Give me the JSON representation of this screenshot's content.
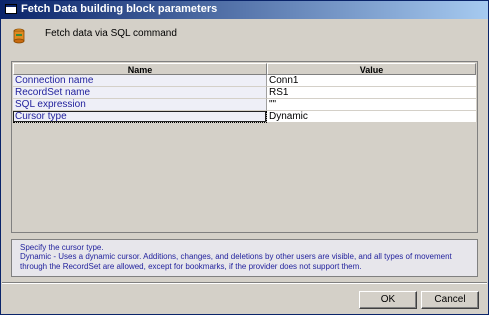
{
  "window": {
    "title": "Fetch Data building block parameters"
  },
  "header": {
    "text": "Fetch data via SQL command"
  },
  "grid": {
    "columns": {
      "name": "Name",
      "value": "Value"
    },
    "rows": [
      {
        "name": "Connection name",
        "value": "Conn1"
      },
      {
        "name": "RecordSet name",
        "value": "RS1"
      },
      {
        "name": "SQL expression",
        "value": "\"\""
      },
      {
        "name": "Cursor type",
        "value": "Dynamic"
      }
    ]
  },
  "description": {
    "title": "Specify the cursor type.",
    "body": "Dynamic - Uses a dynamic cursor. Additions, changes, and deletions by other users are visible, and all types of movement through the RecordSet are allowed, except for bookmarks, if the provider does not support them."
  },
  "buttons": {
    "ok": "OK",
    "cancel": "Cancel"
  },
  "colors": {
    "titlebar_start": "#0a246a",
    "titlebar_end": "#a6caf0",
    "name_text": "#1f1f9c",
    "face": "#d4d0c8"
  }
}
